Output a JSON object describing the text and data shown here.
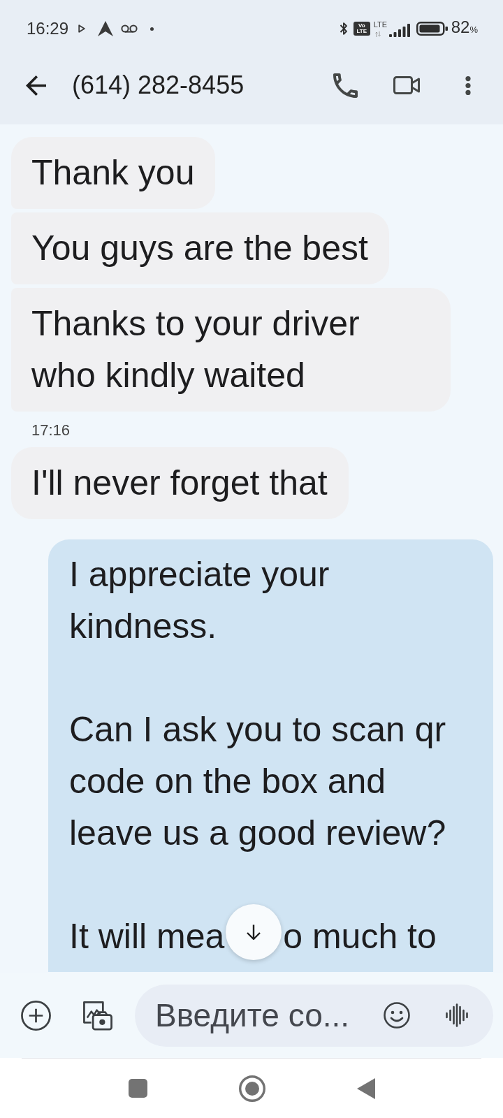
{
  "status_bar": {
    "time": "16:29",
    "volte_badge": [
      "Vo",
      "LTE"
    ],
    "network": "LTE",
    "battery": {
      "value": "82",
      "unit": "%"
    }
  },
  "toolbar": {
    "title": "(614) 282-8455"
  },
  "messages": [
    {
      "kind": "incoming",
      "text": "Thank you"
    },
    {
      "kind": "incoming",
      "text": "You guys are the best"
    },
    {
      "kind": "incoming",
      "text": "Thanks to your driver who kindly waited"
    },
    {
      "kind": "timestamp",
      "text": "17:16"
    },
    {
      "kind": "incoming",
      "text": "I'll never forget that"
    },
    {
      "kind": "outgoing",
      "paragraphs": [
        "I appreciate your kindness.",
        "Can I ask you to scan qr code on the box and leave us a good review?"
      ],
      "covered_line": [
        "It will mea",
        "o much to"
      ]
    }
  ],
  "composer": {
    "placeholder": "Введите со..."
  }
}
